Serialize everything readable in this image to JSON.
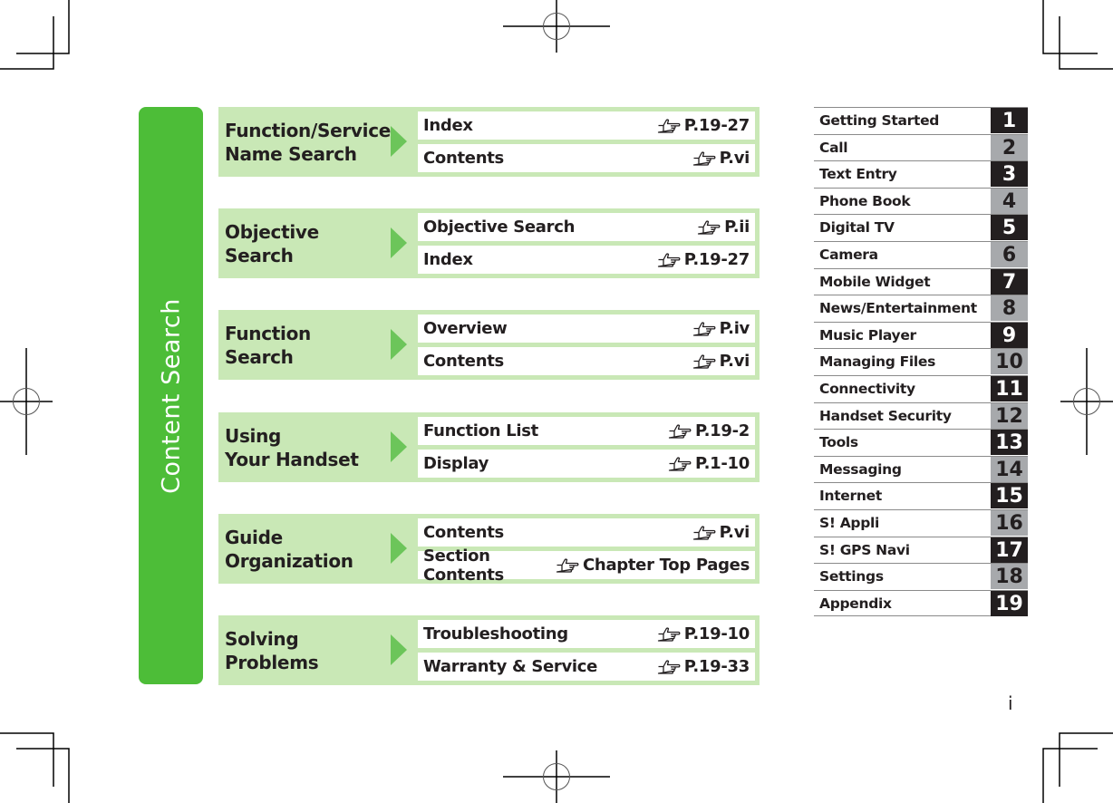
{
  "side_tab": {
    "label": "Content Search",
    "color": "#4dbd38"
  },
  "colors": {
    "panel_bg": "#c9e8b6",
    "arrow": "#6cc55a",
    "chapter_dark": "#231f20",
    "chapter_gray": "#a7a9ac"
  },
  "panels": [
    {
      "title": "Function/Service Name Search",
      "entries": [
        {
          "label": "Index",
          "ref": "P.19-27"
        },
        {
          "label": "Contents",
          "ref": "P.vi"
        }
      ]
    },
    {
      "title": "Objective Search",
      "entries": [
        {
          "label": "Objective Search",
          "ref": "P.ii"
        },
        {
          "label": "Index",
          "ref": "P.19-27"
        }
      ]
    },
    {
      "title": "Function Search",
      "entries": [
        {
          "label": "Overview",
          "ref": "P.iv"
        },
        {
          "label": "Contents",
          "ref": "P.vi"
        }
      ]
    },
    {
      "title": "Using Your Handset",
      "entries": [
        {
          "label": "Function List",
          "ref": "P.19-2"
        },
        {
          "label": "Display",
          "ref": "P.1-10"
        }
      ]
    },
    {
      "title": "Guide Organization",
      "entries": [
        {
          "label": "Contents",
          "ref": "P.vi"
        },
        {
          "label": "Section Contents",
          "ref": "Chapter Top Pages"
        }
      ]
    },
    {
      "title": "Solving Problems",
      "entries": [
        {
          "label": "Troubleshooting",
          "ref": "P.19-10"
        },
        {
          "label": "Warranty & Service",
          "ref": "P.19-33"
        }
      ]
    }
  ],
  "panel_title_lines": [
    [
      "Function/Service",
      "Name Search"
    ],
    [
      "Objective Search"
    ],
    [
      "Function Search"
    ],
    [
      "Using",
      "Your Handset"
    ],
    [
      "Guide",
      "Organization"
    ],
    [
      "Solving",
      "Problems"
    ]
  ],
  "reference_icon": "pointing-hand-icon",
  "chapters": [
    {
      "label": "Getting Started",
      "number": "1"
    },
    {
      "label": "Call",
      "number": "2"
    },
    {
      "label": "Text Entry",
      "number": "3"
    },
    {
      "label": "Phone Book",
      "number": "4"
    },
    {
      "label": "Digital TV",
      "number": "5"
    },
    {
      "label": "Camera",
      "number": "6"
    },
    {
      "label": "Mobile Widget",
      "number": "7"
    },
    {
      "label": "News/Entertainment",
      "number": "8"
    },
    {
      "label": "Music Player",
      "number": "9"
    },
    {
      "label": "Managing Files",
      "number": "10"
    },
    {
      "label": "Connectivity",
      "number": "11"
    },
    {
      "label": "Handset Security",
      "number": "12"
    },
    {
      "label": "Tools",
      "number": "13"
    },
    {
      "label": "Messaging",
      "number": "14"
    },
    {
      "label": "Internet",
      "number": "15"
    },
    {
      "label": "S! Appli",
      "number": "16"
    },
    {
      "label": "S! GPS Navi",
      "number": "17"
    },
    {
      "label": "Settings",
      "number": "18"
    },
    {
      "label": "Appendix",
      "number": "19"
    }
  ],
  "page_number": "i"
}
